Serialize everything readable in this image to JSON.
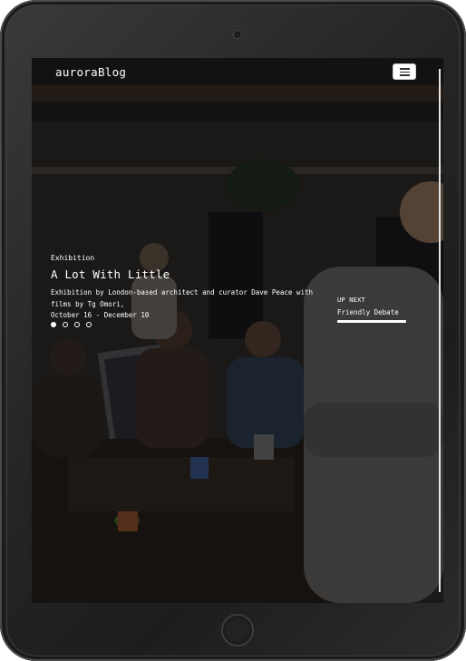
{
  "nav": {
    "brand": "auroraBlog",
    "menu_icon": "hamburger-icon"
  },
  "hero": {
    "category": "Exhibition",
    "title": "A Lot With Little",
    "description_line1": "Exhibition by London-based architect and curator Dave Peace with",
    "description_line2": "films by Tg Omori,",
    "dates": "October 16 - December 10"
  },
  "carousel": {
    "total_slides": 4,
    "active_index": 0
  },
  "up_next": {
    "label": "UP NEXT",
    "title": "Friendly Debate",
    "progress": 1.0
  },
  "colors": {
    "text": "#ffffff",
    "device_frame": "#262626",
    "overlay": "#000000"
  }
}
